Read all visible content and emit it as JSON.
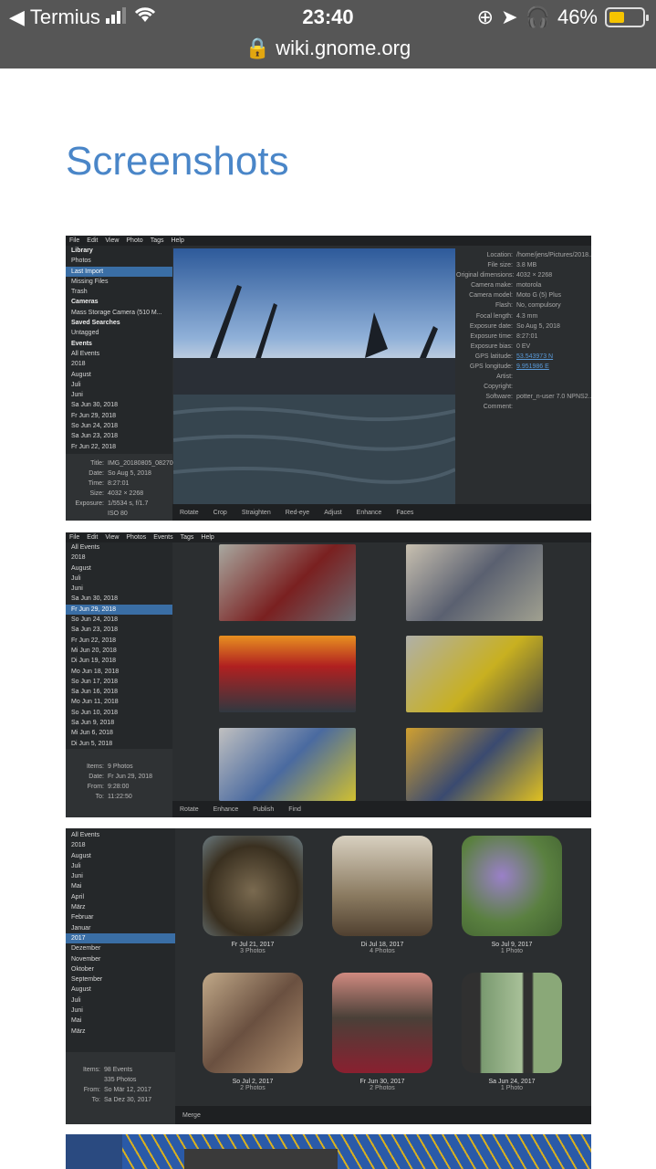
{
  "statusbar": {
    "carrier": "Termius",
    "time": "23:40",
    "battery": "46%",
    "url": "wiki.gnome.org"
  },
  "page": {
    "title": "Screenshots"
  },
  "shot1": {
    "menu": [
      "File",
      "Edit",
      "View",
      "Photo",
      "Tags",
      "Help"
    ],
    "sidebar": [
      {
        "label": "Library",
        "type": "hdr"
      },
      {
        "label": "Photos"
      },
      {
        "label": "Last Import",
        "sel": true
      },
      {
        "label": "Missing Files"
      },
      {
        "label": "Trash"
      },
      {
        "label": "Cameras",
        "type": "hdr"
      },
      {
        "label": "Mass Storage Camera (510 M..."
      },
      {
        "label": "Saved Searches",
        "type": "hdr"
      },
      {
        "label": "Untagged"
      },
      {
        "label": "Events",
        "type": "hdr"
      },
      {
        "label": "All Events"
      },
      {
        "label": "2018"
      },
      {
        "label": "August"
      },
      {
        "label": "Juli"
      },
      {
        "label": "Juni"
      },
      {
        "label": "Sa Jun 30, 2018"
      },
      {
        "label": "Fr Jun 29, 2018"
      },
      {
        "label": "So Jun 24, 2018"
      },
      {
        "label": "Sa Jun 23, 2018"
      },
      {
        "label": "Fr Jun 22, 2018"
      }
    ],
    "info": [
      {
        "k": "Title:",
        "v": "IMG_20180805_0827009..."
      },
      {
        "k": "Date:",
        "v": "So Aug 5, 2018"
      },
      {
        "k": "Time:",
        "v": "8:27:01"
      },
      {
        "k": "Size:",
        "v": "4032 × 2268"
      },
      {
        "k": "Exposure:",
        "v": "1/5534 s, f/1.7"
      },
      {
        "k": "",
        "v": "ISO 80"
      }
    ],
    "metadata": [
      {
        "k": "Location:",
        "v": "/home/jens/Pictures/2018..."
      },
      {
        "k": "File size:",
        "v": "3.8 MB"
      },
      {
        "k": "Original dimensions:",
        "v": "4032 × 2268"
      },
      {
        "k": "Camera make:",
        "v": "motorola"
      },
      {
        "k": "Camera model:",
        "v": "Moto G (5) Plus"
      },
      {
        "k": "Flash:",
        "v": "No, compulsory"
      },
      {
        "k": "Focal length:",
        "v": "4.3 mm"
      },
      {
        "k": "Exposure date:",
        "v": "So Aug 5, 2018"
      },
      {
        "k": "Exposure time:",
        "v": "8:27:01"
      },
      {
        "k": "Exposure bias:",
        "v": "0 EV"
      },
      {
        "k": "GPS latitude:",
        "v": "53.543973 N"
      },
      {
        "k": "GPS longitude:",
        "v": "9.951986 E"
      },
      {
        "k": "Artist:",
        "v": ""
      },
      {
        "k": "Copyright:",
        "v": ""
      },
      {
        "k": "Software:",
        "v": "potter_n-user 7.0 NPNS2..."
      },
      {
        "k": "Comment:",
        "v": ""
      }
    ],
    "toolbar": [
      "Rotate",
      "Crop",
      "Straighten",
      "Red-eye",
      "Adjust",
      "Enhance",
      "Faces"
    ]
  },
  "shot2": {
    "menu": [
      "File",
      "Edit",
      "View",
      "Photos",
      "Events",
      "Tags",
      "Help"
    ],
    "sidebar": [
      {
        "label": "All Events"
      },
      {
        "label": "2018"
      },
      {
        "label": "August"
      },
      {
        "label": "Juli"
      },
      {
        "label": "Juni"
      },
      {
        "label": "Sa Jun 30, 2018"
      },
      {
        "label": "Fr Jun 29, 2018",
        "sel": true
      },
      {
        "label": "So Jun 24, 2018"
      },
      {
        "label": "Sa Jun 23, 2018"
      },
      {
        "label": "Fr Jun 22, 2018"
      },
      {
        "label": "Mi Jun 20, 2018"
      },
      {
        "label": "Di Jun 19, 2018"
      },
      {
        "label": "Mo Jun 18, 2018"
      },
      {
        "label": "So Jun 17, 2018"
      },
      {
        "label": "Sa Jun 16, 2018"
      },
      {
        "label": "Mo Jun 11, 2018"
      },
      {
        "label": "So Jun 10, 2018"
      },
      {
        "label": "Sa Jun 9, 2018"
      },
      {
        "label": "Mi Jun 6, 2018"
      },
      {
        "label": "Di Jun 5, 2018"
      },
      {
        "label": "Mo Jun 4, 2018"
      }
    ],
    "info": [
      {
        "k": "Items:",
        "v": "9 Photos"
      },
      {
        "k": "Date:",
        "v": "Fr Jun 29, 2018"
      },
      {
        "k": "From:",
        "v": "9:28:00"
      },
      {
        "k": "To:",
        "v": "11:22:50"
      }
    ],
    "toolbar": [
      "Rotate",
      "Enhance",
      "Publish",
      "Find"
    ]
  },
  "shot3": {
    "sidebar": [
      {
        "label": "All Events"
      },
      {
        "label": "2018"
      },
      {
        "label": "August"
      },
      {
        "label": "Juli"
      },
      {
        "label": "Juni"
      },
      {
        "label": "Mai"
      },
      {
        "label": "April"
      },
      {
        "label": "März"
      },
      {
        "label": "Februar"
      },
      {
        "label": "Januar"
      },
      {
        "label": "2017",
        "sel": true
      },
      {
        "label": "Dezember"
      },
      {
        "label": "November"
      },
      {
        "label": "Oktober"
      },
      {
        "label": "September"
      },
      {
        "label": "August"
      },
      {
        "label": "Juli"
      },
      {
        "label": "Juni"
      },
      {
        "label": "Mai"
      },
      {
        "label": "März"
      }
    ],
    "info": [
      {
        "k": "Items:",
        "v": "98 Events"
      },
      {
        "k": "",
        "v": "335 Photos"
      },
      {
        "k": "From:",
        "v": "So Mär 12, 2017"
      },
      {
        "k": "To:",
        "v": "Sa Dez 30, 2017"
      }
    ],
    "events": [
      {
        "date": "Fr Jul 21, 2017",
        "count": "3 Photos"
      },
      {
        "date": "Di Jul 18, 2017",
        "count": "4 Photos"
      },
      {
        "date": "So Jul 9, 2017",
        "count": "1 Photo"
      },
      {
        "date": "So Jul 2, 2017",
        "count": "2 Photos"
      },
      {
        "date": "Fr Jun 30, 2017",
        "count": "2 Photos"
      },
      {
        "date": "Sa Jun 24, 2017",
        "count": "1 Photo"
      }
    ],
    "toolbar": [
      "Merge"
    ]
  }
}
